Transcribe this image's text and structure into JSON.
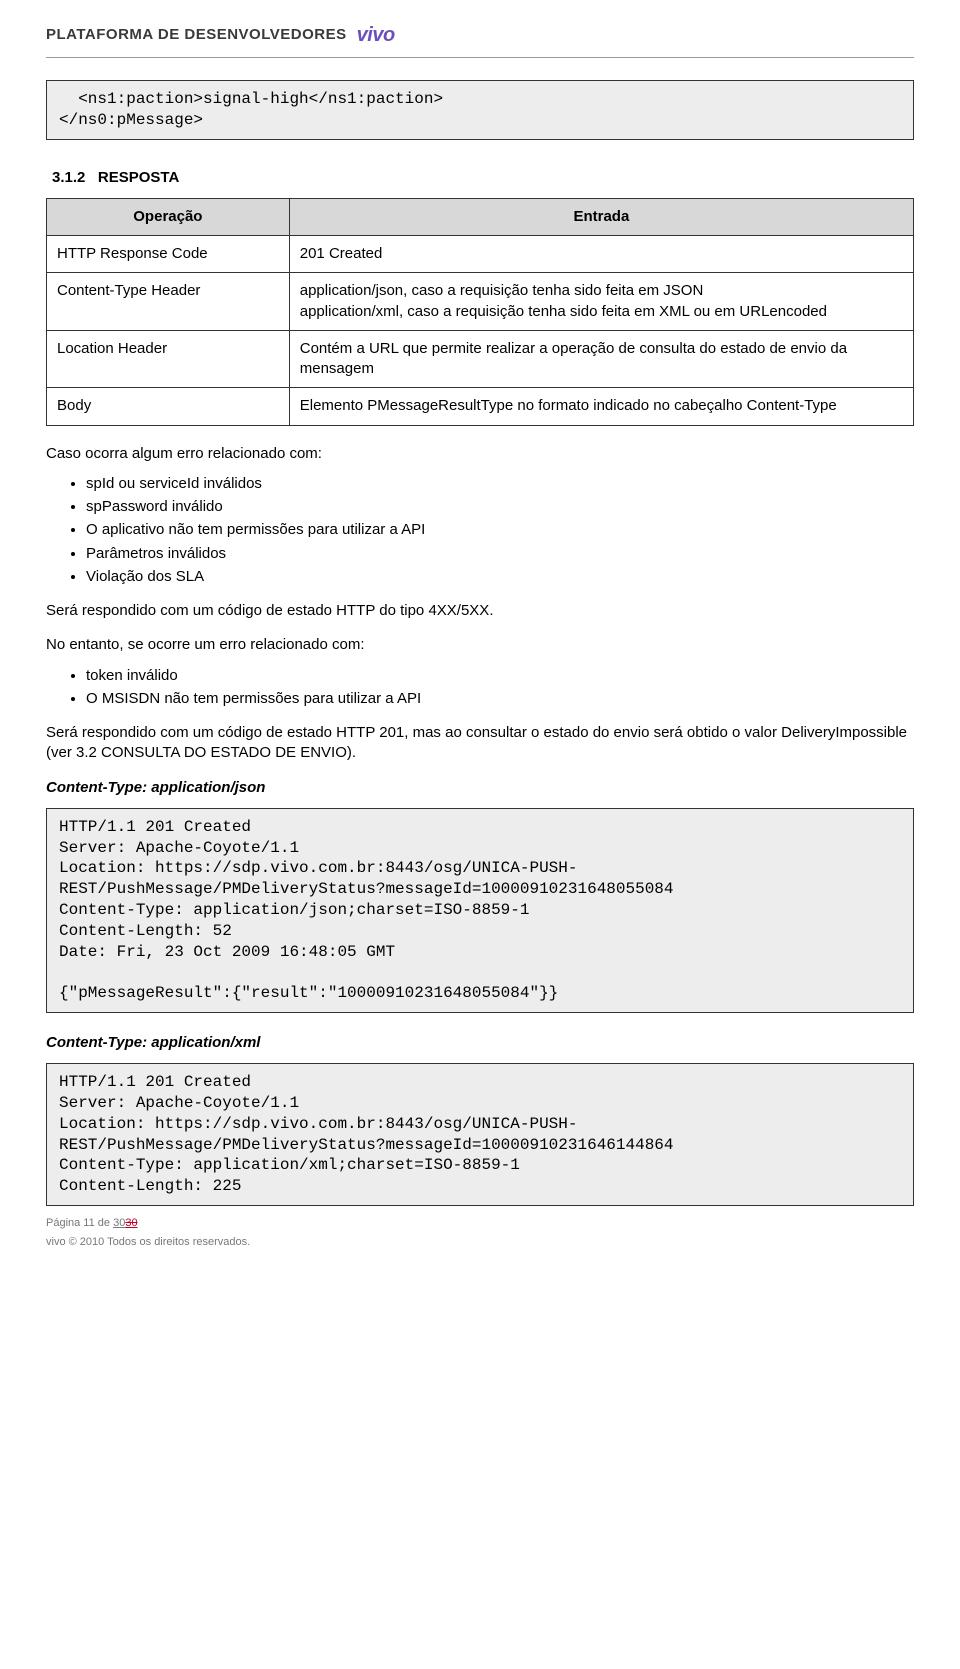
{
  "header": {
    "title": "PLATAFORMA DE DESENVOLVEDORES",
    "brand": "vivo"
  },
  "code1": "  <ns1:paction>signal-high</ns1:paction>\n</ns0:pMessage>",
  "sec": {
    "num": "3.1.2",
    "name": "RESPOSTA"
  },
  "table": {
    "h1": "Operação",
    "h2": "Entrada",
    "rows": [
      {
        "op": "HTTP Response Code",
        "ent": "201 Created"
      },
      {
        "op": "Content-Type Header",
        "ent": "application/json, caso a requisição tenha sido feita em JSON\napplication/xml, caso a requisição tenha sido feita em XML ou em URLencoded"
      },
      {
        "op": "Location Header",
        "ent": "Contém a URL que permite realizar a operação de consulta do estado de envio da mensagem"
      },
      {
        "op": "Body",
        "ent": "Elemento PMessageResultType no formato indicado no cabeçalho Content-Type"
      }
    ]
  },
  "p1": "Caso ocorra algum erro relacionado com:",
  "list1": [
    "spId ou serviceId inválidos",
    "spPassword inválido",
    "O aplicativo não tem permissões para utilizar a API",
    "Parâmetros inválidos",
    "Violação dos SLA"
  ],
  "p2": "Será respondido com um código de estado HTTP do tipo 4XX/5XX.",
  "p3": "No entanto, se ocorre um erro relacionado com:",
  "list2": [
    "token inválido",
    "O MSISDN não tem permissões para utilizar a API"
  ],
  "p4": "Será respondido com um código de estado HTTP 201, mas ao consultar o estado do envio será obtido o valor DeliveryImpossible (ver 3.2 CONSULTA DO ESTADO DE ENVIO).",
  "ct1": "Content-Type: application/json",
  "code2": "HTTP/1.1 201 Created\nServer: Apache-Coyote/1.1\nLocation: https://sdp.vivo.com.br:8443/osg/UNICA-PUSH-REST/PushMessage/PMDeliveryStatus?messageId=10000910231648055084\nContent-Type: application/json;charset=ISO-8859-1\nContent-Length: 52\nDate: Fri, 23 Oct 2009 16:48:05 GMT\n\n{\"pMessageResult\":{\"result\":\"10000910231648055084\"}}",
  "ct2": "Content-Type: application/xml",
  "code3": "HTTP/1.1 201 Created\nServer: Apache-Coyote/1.1\nLocation: https://sdp.vivo.com.br:8443/osg/UNICA-PUSH-REST/PushMessage/PMDeliveryStatus?messageId=10000910231646144864\nContent-Type: application/xml;charset=ISO-8859-1\nContent-Length: 225",
  "footer": {
    "page_prefix": "Página 11 de ",
    "page_total_a": "30",
    "page_total_b": "30",
    "copyright": "vivo © 2010 Todos os direitos reservados."
  }
}
